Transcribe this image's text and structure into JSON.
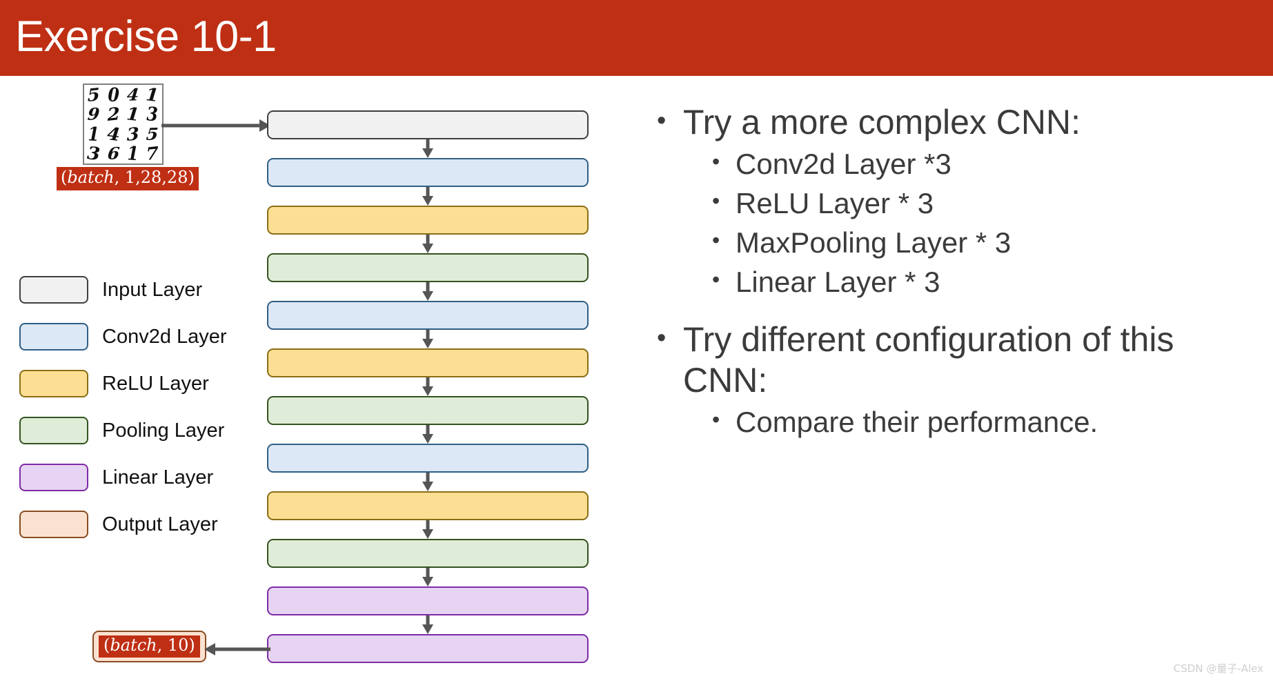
{
  "title": {
    "text": "Exercise 10-1",
    "banner_color": "#bf2f14",
    "text_color": "#ffffff"
  },
  "mnist_figure": {
    "caption_shape": "(batch, 1,28,28)",
    "shape_prefix": "(",
    "shape_italic": "batch",
    "shape_suffix": ", 1,28,28)",
    "digits": [
      [
        "5",
        "0",
        "4",
        "1"
      ],
      [
        "9",
        "2",
        "1",
        "3"
      ],
      [
        "1",
        "4",
        "3",
        "5"
      ],
      [
        "3",
        "6",
        "1",
        "7"
      ]
    ]
  },
  "legend": {
    "items": [
      {
        "label": "Input Layer",
        "fill": "#f1f1f1",
        "border": "#3f3f3f"
      },
      {
        "label": "Conv2d Layer",
        "fill": "#dce8f5",
        "border": "#2e5e85"
      },
      {
        "label": "ReLU Layer",
        "fill": "#fcdf92",
        "border": "#8a6d15"
      },
      {
        "label": "Pooling Layer",
        "fill": "#dfecd7",
        "border": "#33531f"
      },
      {
        "label": "Linear Layer",
        "fill": "#e6d4f2",
        "border": "#7d2ba6"
      },
      {
        "label": "Output Layer",
        "fill": "#fbe2d0",
        "border": "#8a4b22"
      }
    ]
  },
  "flow": {
    "arrow_color": "#555555",
    "layers": [
      {
        "type": "Input Layer",
        "fill": "#f1f1f1",
        "border": "#3f3f3f"
      },
      {
        "type": "Conv2d Layer",
        "fill": "#dce8f5",
        "border": "#2e5e85"
      },
      {
        "type": "ReLU Layer",
        "fill": "#fcdf92",
        "border": "#8a6d15"
      },
      {
        "type": "Pooling Layer",
        "fill": "#dfecd7",
        "border": "#33531f"
      },
      {
        "type": "Conv2d Layer",
        "fill": "#dce8f5",
        "border": "#2e5e85"
      },
      {
        "type": "ReLU Layer",
        "fill": "#fcdf92",
        "border": "#8a6d15"
      },
      {
        "type": "Pooling Layer",
        "fill": "#dfecd7",
        "border": "#33531f"
      },
      {
        "type": "Conv2d Layer",
        "fill": "#dce8f5",
        "border": "#2e5e85"
      },
      {
        "type": "ReLU Layer",
        "fill": "#fcdf92",
        "border": "#8a6d15"
      },
      {
        "type": "Pooling Layer",
        "fill": "#dfecd7",
        "border": "#33531f"
      },
      {
        "type": "Linear Layer",
        "fill": "#e6d4f2",
        "border": "#7d2ba6"
      },
      {
        "type": "Linear Layer",
        "fill": "#e6d4f2",
        "border": "#7d2ba6"
      }
    ]
  },
  "output_label": {
    "shape_prefix": "(",
    "shape_italic": "batch",
    "shape_suffix": ", 10)",
    "full_text": "(batch, 10)"
  },
  "content": {
    "bullets": [
      {
        "level": 1,
        "marker": "•",
        "text": "Try a more complex CNN:"
      },
      {
        "level": 2,
        "marker": "•",
        "text": "Conv2d Layer *3"
      },
      {
        "level": 2,
        "marker": "•",
        "text": "ReLU Layer * 3"
      },
      {
        "level": 2,
        "marker": "•",
        "text": "MaxPooling Layer * 3"
      },
      {
        "level": 2,
        "marker": "•",
        "text": "Linear Layer * 3"
      },
      {
        "level": 1,
        "marker": "•",
        "text": "Try different configuration of this CNN:"
      },
      {
        "level": 2,
        "marker": "•",
        "text": "Compare their performance."
      }
    ]
  },
  "watermark": {
    "text": "CSDN @量子-Alex"
  }
}
